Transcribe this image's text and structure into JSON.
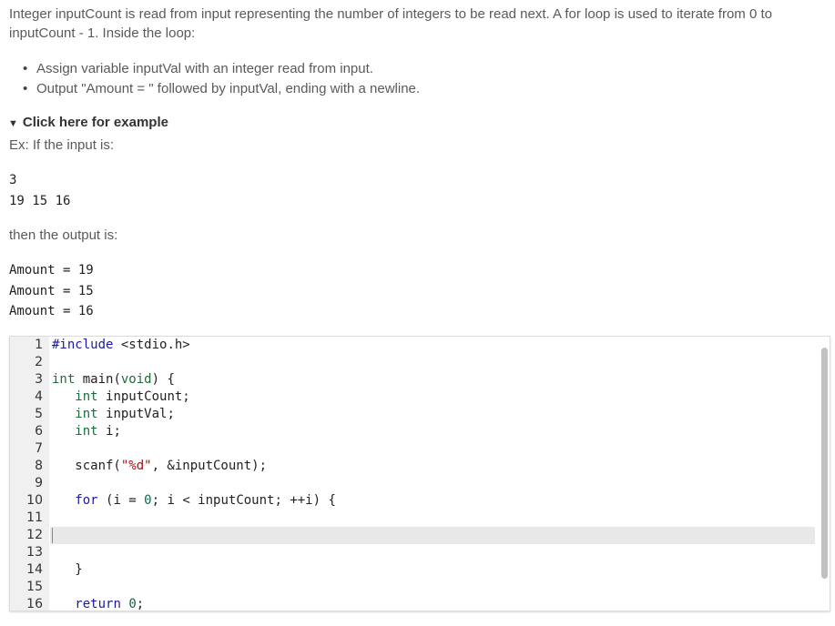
{
  "intro": "Integer inputCount is read from input representing the number of integers to be read next. A for loop is used to iterate from 0 to inputCount - 1. Inside the loop:",
  "bullets": [
    "Assign variable inputVal with an integer read from input.",
    "Output \"Amount = \" followed by inputVal, ending with a newline."
  ],
  "example_toggle": "Click here for example",
  "example_intro": "Ex: If the input is:",
  "example_input": [
    "3",
    "19 15 16"
  ],
  "then_output": "then the output is:",
  "example_output": [
    "Amount = 19",
    "Amount = 15",
    "Amount = 16"
  ],
  "editor": {
    "line_numbers": [
      "1",
      "2",
      "3",
      "4",
      "5",
      "6",
      "7",
      "8",
      "9",
      "10",
      "11",
      "12",
      "13",
      "14",
      "15",
      "16"
    ],
    "lines": [
      "#include <stdio.h>",
      "",
      "int main(void) {",
      "   int inputCount;",
      "   int inputVal;",
      "   int i;",
      "",
      "   scanf(\"%d\", &inputCount);",
      "",
      "   for (i = 0; i < inputCount; ++i) {",
      "",
      "",
      "",
      "   }",
      "",
      "   return 0;"
    ],
    "active_line": 12
  },
  "colors": {
    "keyword": "#1a1aa6",
    "type": "#008855",
    "string": "#aa1111",
    "gutter_bg": "#f0f0f0",
    "active_line_bg": "#e8e8e8"
  }
}
